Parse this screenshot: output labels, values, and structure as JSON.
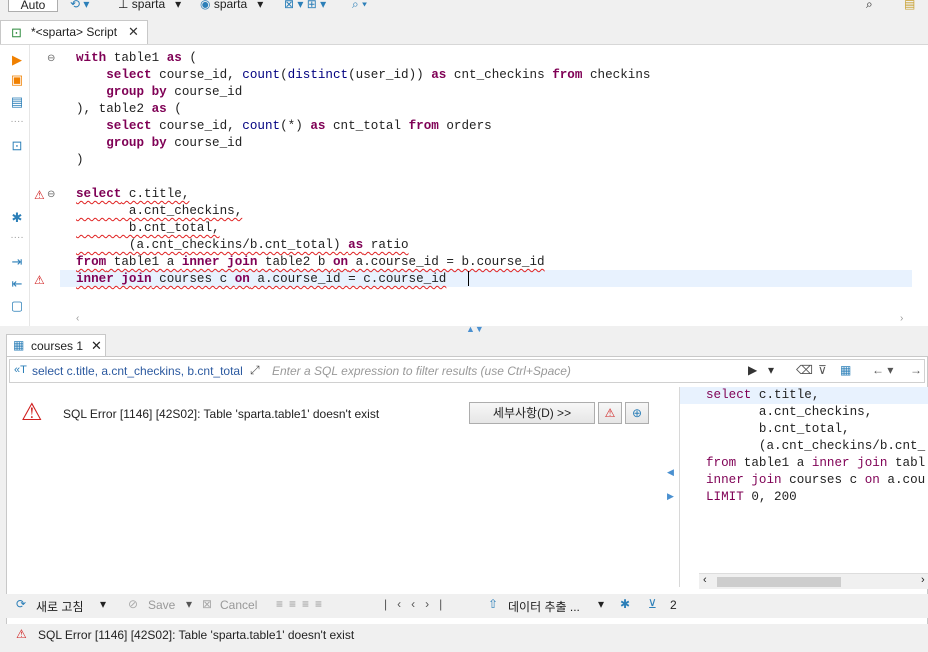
{
  "toolbar": {
    "auto_label": "Auto",
    "datasource_label": "sparta",
    "schema_label": "sparta"
  },
  "editor_tab": {
    "title": "*<sparta> Script",
    "close": "✕"
  },
  "editor": {
    "lines": [
      [
        {
          "t": "with",
          "c": "kw"
        },
        {
          "t": " table1 ",
          "c": ""
        },
        {
          "t": "as",
          "c": "kw"
        },
        {
          "t": " (",
          "c": ""
        }
      ],
      [
        {
          "t": "    select",
          "c": "kw"
        },
        {
          "t": " course_id, ",
          "c": ""
        },
        {
          "t": "count",
          "c": "fn"
        },
        {
          "t": "(",
          "c": ""
        },
        {
          "t": "distinct",
          "c": "fn"
        },
        {
          "t": "(user_id)) ",
          "c": ""
        },
        {
          "t": "as",
          "c": "kw"
        },
        {
          "t": " cnt_checkins ",
          "c": ""
        },
        {
          "t": "from",
          "c": "kw"
        },
        {
          "t": " checkins",
          "c": ""
        }
      ],
      [
        {
          "t": "    group by",
          "c": "kw"
        },
        {
          "t": " course_id",
          "c": ""
        }
      ],
      [
        {
          "t": "), table2 ",
          "c": ""
        },
        {
          "t": "as",
          "c": "kw"
        },
        {
          "t": " (",
          "c": ""
        }
      ],
      [
        {
          "t": "    select",
          "c": "kw"
        },
        {
          "t": " course_id, ",
          "c": ""
        },
        {
          "t": "count",
          "c": "fn"
        },
        {
          "t": "(*) ",
          "c": ""
        },
        {
          "t": "as",
          "c": "kw"
        },
        {
          "t": " cnt_total ",
          "c": ""
        },
        {
          "t": "from",
          "c": "kw"
        },
        {
          "t": " orders",
          "c": ""
        }
      ],
      [
        {
          "t": "    group by",
          "c": "kw"
        },
        {
          "t": " course_id",
          "c": ""
        }
      ],
      [
        {
          "t": ")",
          "c": ""
        }
      ],
      [],
      [
        {
          "t": "select",
          "c": "kw err"
        },
        {
          "t": " c.title,",
          "c": "err"
        }
      ],
      [
        {
          "t": "       a.cnt_checkins,",
          "c": "err"
        }
      ],
      [
        {
          "t": "       b.cnt_total,",
          "c": "err"
        }
      ],
      [
        {
          "t": "       (a.cnt_checkins/b.cnt_total) ",
          "c": "err"
        },
        {
          "t": "as",
          "c": "kw err"
        },
        {
          "t": " ratio",
          "c": "err"
        }
      ],
      [
        {
          "t": "from",
          "c": "kw err"
        },
        {
          "t": " table1 a ",
          "c": "err"
        },
        {
          "t": "inner join",
          "c": "kw err"
        },
        {
          "t": " table2 b ",
          "c": "err"
        },
        {
          "t": "on",
          "c": "kw err"
        },
        {
          "t": " a.course_id = b.course_id",
          "c": "err"
        }
      ],
      [
        {
          "t": "inner join",
          "c": "kw err"
        },
        {
          "t": " courses c ",
          "c": "err"
        },
        {
          "t": "on",
          "c": "kw err"
        },
        {
          "t": " a.course_id = c.course_id",
          "c": "err"
        }
      ]
    ]
  },
  "results": {
    "tab_label": "courses 1",
    "tab_close": "✕",
    "query_preview": "select c.title, a.cnt_checkins, b.cnt_total",
    "filter_placeholder": "Enter a SQL expression to filter results (use Ctrl+Space)",
    "error_message": "SQL Error [1146] [42S02]: Table 'sparta.table1' doesn't exist",
    "details_button": "세부사항(D) >>",
    "sql_lines": [
      [
        {
          "t": "select",
          "c": "kw2"
        },
        {
          "t": " c.title,",
          "c": ""
        }
      ],
      [
        {
          "t": "       a.cnt_checkins,",
          "c": ""
        }
      ],
      [
        {
          "t": "       b.cnt_total,",
          "c": ""
        }
      ],
      [
        {
          "t": "       (a.cnt_checkins/b.cnt_",
          "c": ""
        }
      ],
      [
        {
          "t": "from",
          "c": "kw2"
        },
        {
          "t": " table1 a ",
          "c": ""
        },
        {
          "t": "inner join",
          "c": "kw2"
        },
        {
          "t": " tabl",
          "c": ""
        }
      ],
      [
        {
          "t": "inner join",
          "c": "kw2"
        },
        {
          "t": " courses c ",
          "c": ""
        },
        {
          "t": "on",
          "c": "kw2"
        },
        {
          "t": " a.cou",
          "c": ""
        }
      ],
      [
        {
          "t": "LIMIT",
          "c": "kw2"
        },
        {
          "t": " 0, 200",
          "c": ""
        }
      ]
    ]
  },
  "bottom_toolbar": {
    "refresh": "새로 고침",
    "save": "Save",
    "cancel": "Cancel",
    "export": "데이터 추출 ...",
    "count": "2"
  },
  "status": {
    "message": "SQL Error [1146] [42S02]: Table 'sparta.table1' doesn't exist"
  },
  "colors": {
    "keyword": "#7f0055",
    "error": "#e02020",
    "accent": "#2c7fb8"
  }
}
